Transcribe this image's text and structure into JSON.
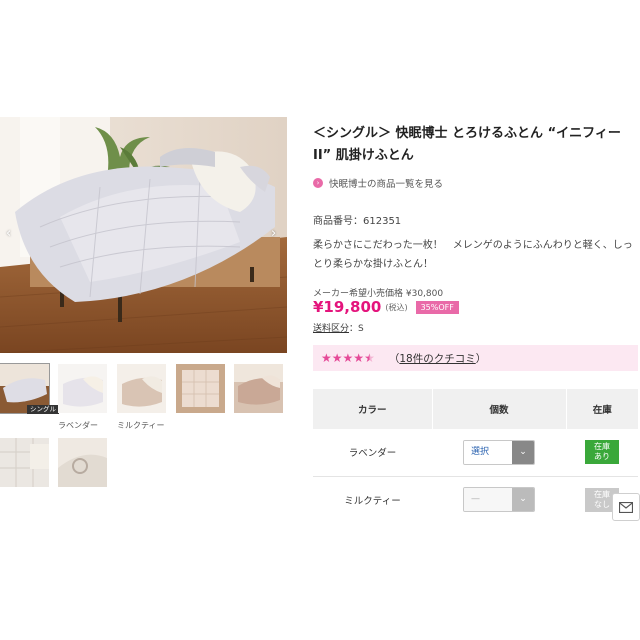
{
  "product": {
    "title": "＜シングル＞ 快眠博士 とろけるふとん “イニフィーII” 肌掛けふとん",
    "brand_link": "快眠博士の商品一覧を見る",
    "sku_label": "商品番号：",
    "sku": "612351",
    "description": "柔らかさにこだわった一枚！　メレンゲのようにふんわりと軽く、しっとり柔らかな掛けふとん！",
    "list_price_text": "メーカー希望小売価格 ¥30,800",
    "price": "¥19,800",
    "tax": "(税込)",
    "discount": "35%OFF",
    "shipping_label": "送料区分",
    "shipping_value": "：S"
  },
  "reviews": {
    "stars": "★★★★★",
    "rating": 4.5,
    "open_paren": "（",
    "count_text": "18件のクチコミ",
    "close_paren": "）"
  },
  "gallery": {
    "prev_icon": "‹",
    "next_icon": "›",
    "selected_badge": "シングル",
    "captions": [
      "ラベンダー",
      "ミルクティー"
    ]
  },
  "table": {
    "headers": [
      "カラー",
      "個数",
      "在庫"
    ],
    "rows": [
      {
        "color": "ラベンダー",
        "select": "選択",
        "chevron": "⌄",
        "stock_line1": "在庫",
        "stock_line2": "あり"
      },
      {
        "color": "ミルクティー",
        "select": "—",
        "chevron": "⌄",
        "stock_line1": "在庫",
        "stock_line2": "なし"
      }
    ]
  },
  "colors": {
    "accent_pink": "#e4147c",
    "review_bg": "#fce8f2",
    "in_stock": "#3aa83a",
    "out_stock": "#c9c9c9"
  },
  "icons": {
    "brand_link": "chevron-right-circle-icon",
    "mail": "mail-icon"
  }
}
